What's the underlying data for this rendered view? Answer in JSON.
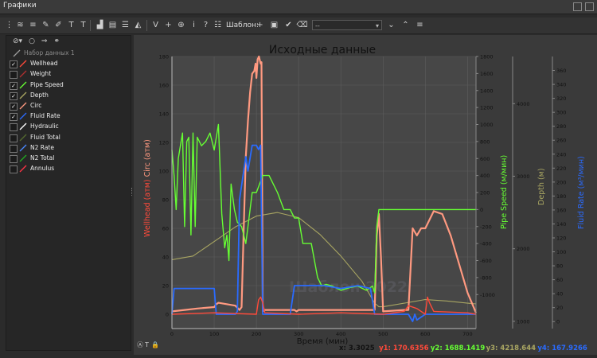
{
  "window": {
    "title": "Графики"
  },
  "toolbar": {
    "template_label": "Шаблон:",
    "template_value": "--",
    "icons": [
      "drag-handle-icon",
      "wave-icon",
      "lines-icon",
      "tool-icon",
      "text-t-icon",
      "text-t2-icon",
      "bucket-icon",
      "graph-icon",
      "lines2-icon",
      "mountain-icon",
      "vcursor-icon",
      "crosshair-icon",
      "zoom-icon",
      "info-icon",
      "help-icon",
      "list-icon"
    ]
  },
  "sidebar": {
    "tools": [
      "filter-icon",
      "circle-icon",
      "arrow-icon",
      "binoculars-icon"
    ],
    "items": [
      {
        "label": "Набор данных 1",
        "checked": false,
        "color": "#9a9a9a",
        "group": true
      },
      {
        "label": "Wellhead",
        "checked": true,
        "color": "#ff4a3a"
      },
      {
        "label": "Weight",
        "checked": false,
        "color": "#b03030"
      },
      {
        "label": "Pipe Speed",
        "checked": true,
        "color": "#66ff33"
      },
      {
        "label": "Depth",
        "checked": true,
        "color": "#a9a662"
      },
      {
        "label": "Circ",
        "checked": true,
        "color": "#ff9980"
      },
      {
        "label": "Fluid Rate",
        "checked": true,
        "color": "#2a6bff"
      },
      {
        "label": "Hydraulic",
        "checked": false,
        "color": "#ffffff"
      },
      {
        "label": "Fluid Total",
        "checked": false,
        "color": "#556b2f"
      },
      {
        "label": "N2 Rate",
        "checked": false,
        "color": "#4a88ff"
      },
      {
        "label": "N2 Total",
        "checked": false,
        "color": "#22aa22"
      },
      {
        "label": "Annulus",
        "checked": false,
        "color": "#ff3344"
      }
    ]
  },
  "colors": {
    "wellhead": "#ff4a3a",
    "circ": "#ff9980",
    "pipe": "#66ff33",
    "depth": "#a9a662",
    "fluid": "#2a6bff"
  },
  "chart_data": {
    "type": "line",
    "title": "Исходные данные",
    "xlabel": "Время (мин)",
    "xlim": [
      0,
      720
    ],
    "x_ticks": [
      0,
      100,
      200,
      300,
      400,
      500,
      600,
      700
    ],
    "left_axis": {
      "label": "Wellhead (атм) Circ (атм)",
      "label_a": "Wellhead",
      "label_b": "(атм)",
      "label_c": "Circ (атм)",
      "ylim": [
        -10,
        180
      ],
      "ticks": [
        0,
        20,
        40,
        60,
        80,
        100,
        120,
        140,
        160,
        180
      ]
    },
    "pipe_axis": {
      "label": "Pipe Speed (м/мин)",
      "ylim": [
        -1400,
        1800
      ],
      "ticks": [
        -1000,
        -800,
        -600,
        -400,
        -200,
        0,
        200,
        400,
        600,
        800,
        1000,
        1200,
        1400,
        1600,
        1800
      ]
    },
    "depth_axis": {
      "label": "Depth (м)",
      "ticks": [
        1000,
        2000,
        3000,
        4000
      ]
    },
    "fluid_axis": {
      "label": "Fluid Rate (м³/мин)",
      "ticks": [
        0,
        20,
        40,
        60,
        80,
        100,
        120,
        140,
        160,
        180,
        200,
        220,
        240,
        260,
        280,
        300,
        320,
        340,
        360
      ]
    },
    "series": [
      {
        "name": "Circ",
        "color": "#ff9980",
        "axis": "left",
        "x": [
          0,
          30,
          60,
          100,
          105,
          110,
          150,
          160,
          165,
          170,
          175,
          180,
          185,
          190,
          195,
          198,
          200,
          203,
          206,
          210,
          212,
          215,
          220,
          260,
          290,
          295,
          300,
          320,
          360,
          400,
          440,
          470,
          480,
          485,
          490,
          495,
          500,
          550,
          560,
          570,
          580,
          590,
          600,
          620,
          640,
          660,
          680,
          700,
          720
        ],
        "y": [
          2,
          3,
          4,
          5,
          7,
          8,
          6,
          3,
          5,
          60,
          110,
          135,
          155,
          168,
          170,
          175,
          165,
          178,
          180,
          175,
          176,
          2,
          3,
          3,
          3,
          2,
          3,
          3,
          3,
          3,
          3,
          3,
          3,
          55,
          70,
          40,
          2,
          3,
          3,
          60,
          55,
          60,
          60,
          72,
          70,
          55,
          35,
          15,
          1
        ]
      },
      {
        "name": "Wellhead",
        "color": "#ff4a3a",
        "axis": "left",
        "x": [
          0,
          100,
          200,
          205,
          210,
          215,
          220,
          300,
          400,
          500,
          550,
          560,
          580,
          600,
          605,
          610,
          620,
          700,
          720
        ],
        "y": [
          0,
          1,
          0,
          10,
          12,
          8,
          1,
          0,
          1,
          0,
          2,
          6,
          4,
          0,
          12,
          8,
          2,
          1,
          0
        ]
      },
      {
        "name": "Pipe Speed",
        "color": "#66ff33",
        "axis": "pipe",
        "x": [
          0,
          5,
          10,
          15,
          20,
          25,
          30,
          35,
          40,
          45,
          50,
          55,
          60,
          70,
          80,
          90,
          100,
          110,
          118,
          125,
          130,
          135,
          140,
          148,
          155,
          165,
          170,
          175,
          180,
          190,
          200,
          215,
          230,
          250,
          265,
          280,
          290,
          300,
          310,
          330,
          345,
          355,
          365,
          380,
          400,
          420,
          440,
          460,
          475,
          480,
          485,
          490,
          500,
          520,
          540,
          560,
          580,
          600,
          650,
          700,
          720
        ],
        "y": [
          700,
          400,
          0,
          600,
          750,
          900,
          -200,
          800,
          850,
          -300,
          900,
          -200,
          850,
          750,
          800,
          900,
          700,
          1000,
          -50,
          -450,
          -300,
          -600,
          300,
          0,
          -150,
          -200,
          -300,
          -400,
          -200,
          200,
          200,
          400,
          400,
          200,
          0,
          0,
          -100,
          -100,
          -400,
          -400,
          -800,
          -900,
          -880,
          -900,
          -950,
          -920,
          -900,
          -950,
          -900,
          -980,
          -200,
          0,
          0,
          0,
          0,
          0,
          0,
          0,
          0,
          0,
          0
        ]
      },
      {
        "name": "Depth",
        "color": "#a9a662",
        "axis": "depth",
        "x": [
          0,
          50,
          100,
          150,
          200,
          250,
          300,
          350,
          400,
          450,
          480,
          490,
          500,
          550,
          600,
          650,
          700,
          720
        ],
        "y": [
          1850,
          1900,
          2100,
          2300,
          2450,
          2500,
          2430,
          2200,
          1900,
          1550,
          1250,
          1200,
          1200,
          1250,
          1300,
          1280,
          1250,
          1240
        ]
      },
      {
        "name": "Fluid Rate",
        "color": "#2a6bff",
        "axis": "left",
        "x": [
          0,
          5,
          10,
          100,
          105,
          110,
          150,
          155,
          160,
          170,
          175,
          180,
          190,
          200,
          205,
          210,
          215,
          260,
          280,
          290,
          300,
          320,
          360,
          400,
          440,
          470,
          480,
          490,
          500,
          560,
          570,
          575,
          580,
          600,
          650,
          720
        ],
        "y": [
          0,
          18,
          18,
          18,
          0,
          0,
          0,
          2,
          80,
          100,
          110,
          100,
          118,
          118,
          115,
          118,
          0,
          0,
          0,
          20,
          20,
          20,
          20,
          18,
          20,
          18,
          0,
          0,
          0,
          0,
          -5,
          0,
          -4,
          0,
          0,
          0
        ]
      }
    ],
    "annotations": [
      "x: 3.3025",
      "y1: 170.6356",
      "y2: 1688.1419",
      "y3: 4218.644",
      "y4: 167.9266"
    ],
    "watermark": "Шаблон 2022",
    "grid": true
  }
}
